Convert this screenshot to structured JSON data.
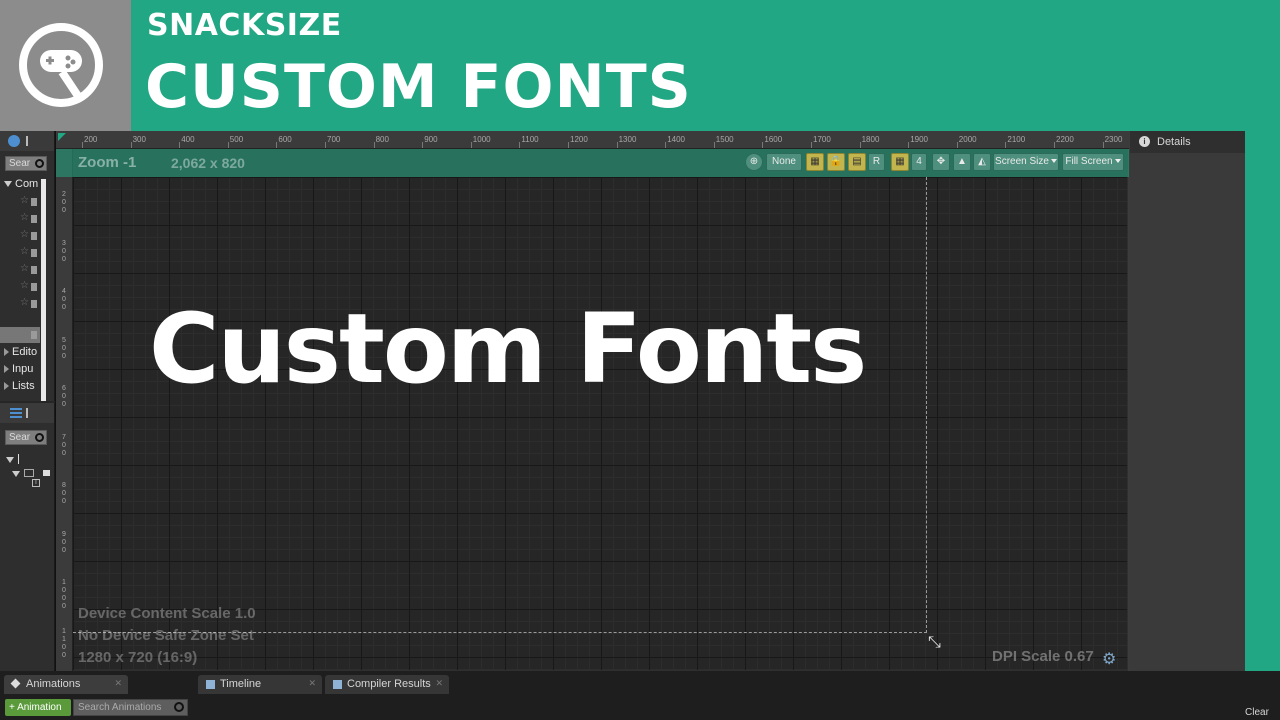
{
  "banner": {
    "subtitle": "SNACKSIZE",
    "title": "CUSTOM FONTS",
    "logo_icon": "gamepad-r-logo-icon",
    "color": "#21a784"
  },
  "palette": {
    "search_placeholder": "Sear",
    "categories": [
      {
        "label": "Com",
        "expanded": true
      },
      {
        "label": "Edito",
        "expanded": false
      },
      {
        "label": "Inpu",
        "expanded": false
      },
      {
        "label": "Lists",
        "expanded": false
      }
    ],
    "items": [
      {
        "label": "C"
      },
      {
        "label": ""
      },
      {
        "label": ""
      },
      {
        "label": ""
      },
      {
        "label": ""
      },
      {
        "label": ""
      },
      {
        "label": ""
      },
      {
        "label": ""
      }
    ]
  },
  "hierarchy": {
    "search_placeholder": "Sear"
  },
  "designer": {
    "zoom": "Zoom -1",
    "resolution": "2,062 x 820",
    "ruler_top": [
      "200",
      "300",
      "400",
      "500",
      "600",
      "700",
      "800",
      "900",
      "1000",
      "1100",
      "1200",
      "1300",
      "1400",
      "1500",
      "1600",
      "1700",
      "1800",
      "1900",
      "2000",
      "2100",
      "2200",
      "2300"
    ],
    "ruler_left": [
      "200",
      "300",
      "400",
      "500",
      "600",
      "700",
      "800",
      "900",
      "1000",
      "1100"
    ],
    "toolbar": {
      "none_label": "None",
      "r_label": "R",
      "four_label": "4",
      "screen_size_label": "Screen Size",
      "fill_screen_label": "Fill Screen"
    },
    "canvas_text": "Custom Fonts",
    "device_content_scale": "Device Content Scale 1.0",
    "safe_zone": "No Device Safe Zone Set",
    "screen_res": "1280 x 720 (16:9)",
    "dpi_scale": "DPI Scale 0.67"
  },
  "details": {
    "tab_label": "Details"
  },
  "bottom": {
    "tabs": [
      {
        "label": "Animations",
        "icon": "pencil-icon"
      },
      {
        "label": "Timeline",
        "icon": "film-icon"
      },
      {
        "label": "Compiler Results",
        "icon": "compiler-icon"
      }
    ],
    "add_animation_label": "+ Animation",
    "search_animations_placeholder": "Search Animations",
    "clear_label": "Clear"
  }
}
